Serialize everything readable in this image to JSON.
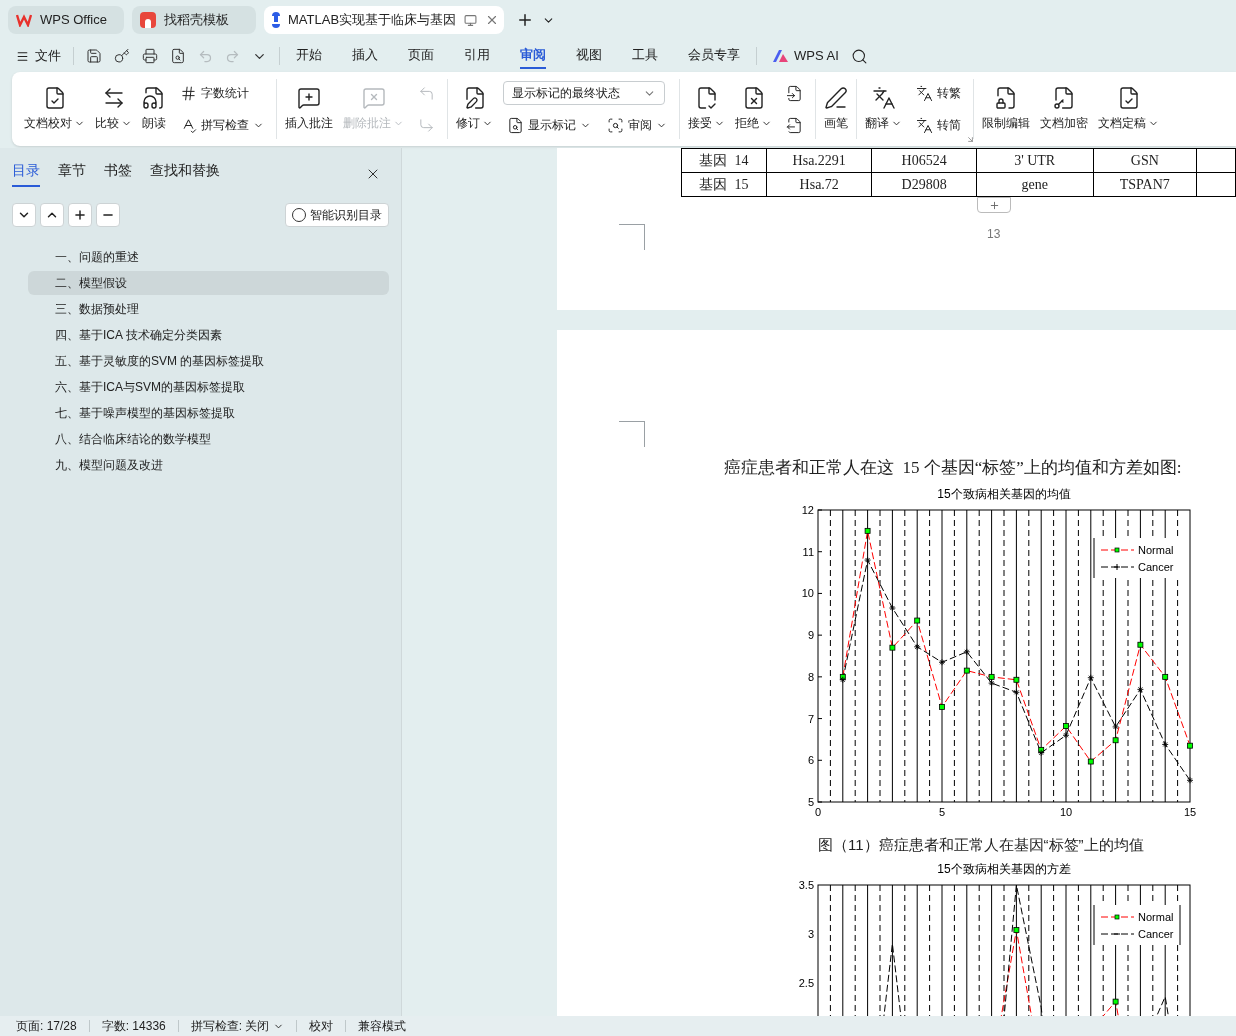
{
  "tabs": [
    {
      "label": "WPS Office",
      "selected": false
    },
    {
      "label": "找稻壳模板",
      "selected": false
    },
    {
      "label": "MATLAB实现基于临床与基因",
      "selected": true
    }
  ],
  "menu": {
    "file": "文件",
    "tabs": [
      {
        "label": "开始",
        "selected": false
      },
      {
        "label": "插入",
        "selected": false
      },
      {
        "label": "页面",
        "selected": false
      },
      {
        "label": "引用",
        "selected": false
      },
      {
        "label": "审阅",
        "selected": true
      },
      {
        "label": "视图",
        "selected": false
      },
      {
        "label": "工具",
        "selected": false
      },
      {
        "label": "会员专享",
        "selected": false
      }
    ],
    "ai": "WPS AI"
  },
  "ribbon": {
    "groups": [
      {
        "items": [
          {
            "kind": "large",
            "label": "文档校对",
            "menu": true,
            "disabled": false
          },
          {
            "kind": "large",
            "label": "比较",
            "menu": true,
            "disabled": false
          },
          {
            "kind": "large",
            "label": "朗读",
            "menu": false,
            "disabled": false
          },
          {
            "kind": "stack",
            "rows": [
              [
                {
                  "kind": "small",
                  "label": "字数统计",
                  "menu": false,
                  "disabled": false
                }
              ],
              [
                {
                  "kind": "small",
                  "label": "拼写检查",
                  "menu": true,
                  "disabled": false
                }
              ]
            ]
          }
        ]
      },
      {
        "items": [
          {
            "kind": "large",
            "label": "插入批注",
            "menu": false,
            "disabled": false
          },
          {
            "kind": "large",
            "label": "删除批注",
            "menu": true,
            "disabled": true
          },
          {
            "kind": "stack",
            "rows": [
              [
                {
                  "kind": "small",
                  "menu": false,
                  "disabled": true
                }
              ],
              [
                {
                  "kind": "small",
                  "menu": false,
                  "disabled": true
                }
              ]
            ]
          }
        ]
      },
      {
        "items": [
          {
            "kind": "large",
            "label": "修订",
            "menu": true,
            "disabled": false
          },
          {
            "kind": "stack",
            "rows": [
              [
                {
                  "kind": "select",
                  "value": "显示标记的最终状态"
                }
              ],
              [
                {
                  "kind": "small",
                  "label": "显示标记",
                  "menu": true,
                  "disabled": false
                },
                {
                  "kind": "small",
                  "label": "审阅",
                  "menu": true,
                  "disabled": false
                }
              ]
            ]
          }
        ]
      },
      {
        "items": [
          {
            "kind": "large",
            "label": "接受",
            "menu": true,
            "disabled": false
          },
          {
            "kind": "large",
            "label": "拒绝",
            "menu": true,
            "disabled": false
          },
          {
            "kind": "stack",
            "rows": [
              [
                {
                  "kind": "small",
                  "menu": false,
                  "disabled": false
                }
              ],
              [
                {
                  "kind": "small",
                  "menu": false,
                  "disabled": false
                }
              ]
            ]
          }
        ]
      },
      {
        "items": [
          {
            "kind": "large",
            "label": "画笔",
            "menu": false,
            "disabled": false
          }
        ]
      },
      {
        "items": [
          {
            "kind": "large",
            "label": "翻译",
            "menu": true,
            "disabled": false
          },
          {
            "kind": "stack",
            "rows": [
              [
                {
                  "kind": "small",
                  "label": "转繁",
                  "menu": false,
                  "disabled": false
                }
              ],
              [
                {
                  "kind": "small",
                  "label": "转简",
                  "menu": false,
                  "disabled": false
                }
              ]
            ]
          }
        ],
        "launcher": true
      },
      {
        "items": [
          {
            "kind": "large",
            "label": "限制编辑",
            "menu": false,
            "disabled": false
          },
          {
            "kind": "large",
            "label": "文档加密",
            "menu": false,
            "disabled": false
          },
          {
            "kind": "large",
            "label": "文档定稿",
            "menu": true,
            "disabled": false
          }
        ]
      }
    ]
  },
  "panel": {
    "tabs": [
      {
        "label": "目录",
        "selected": true
      },
      {
        "label": "章节",
        "selected": false
      },
      {
        "label": "书签",
        "selected": false
      },
      {
        "label": "查找和替换",
        "selected": false
      }
    ],
    "smart_button": "智能识别目录",
    "outline": [
      {
        "label": "一、问题的重述",
        "selected": false
      },
      {
        "label": "二、模型假设",
        "selected": true
      },
      {
        "label": "三、数据预处理",
        "selected": false
      },
      {
        "label": "四、基于ICA 技术确定分类因素",
        "selected": false
      },
      {
        "label": "五、基于灵敏度的SVM 的基因标签提取",
        "selected": false
      },
      {
        "label": "六、基于ICA与SVM的基因标签提取",
        "selected": false
      },
      {
        "label": "七、基于噪声模型的基因标签提取",
        "selected": false
      },
      {
        "label": "八、结合临床结论的数学模型",
        "selected": false
      },
      {
        "label": "九、模型问题及改进",
        "selected": false
      }
    ]
  },
  "document": {
    "table": {
      "rows": [
        [
          "基因  14",
          "Hsa.2291",
          "H06524",
          "3' UTR",
          "GSN"
        ],
        [
          "基因  15",
          "Hsa.72",
          "D29808",
          "gene",
          "TSPAN7"
        ]
      ]
    },
    "page_number": "13",
    "paragraph": "癌症患者和正常人在这  15 个基因“标签”上的均值和方差如图:",
    "figures": [
      {
        "chart_data": {
          "type": "line",
          "title": "15个致病相关基因的均值",
          "x": [
            1,
            2,
            3,
            4,
            5,
            6,
            7,
            8,
            9,
            10,
            11,
            12,
            13,
            14,
            15
          ],
          "xlim": [
            0,
            15
          ],
          "ylim": [
            5,
            12
          ],
          "xticks": [
            0,
            5,
            10,
            15
          ],
          "yticks": [
            5,
            6,
            7,
            8,
            9,
            10,
            11,
            12
          ],
          "legend": true,
          "series": [
            {
              "name": "Normal",
              "color": "#ff0000",
              "line_style": "dashed",
              "marker": "square",
              "values": [
                8.0,
                11.5,
                8.7,
                9.35,
                7.28,
                8.15,
                8.0,
                7.93,
                6.25,
                6.82,
                5.97,
                6.48,
                8.77,
                8.0,
                6.35
              ]
            },
            {
              "name": "Cancer",
              "color": "#000000",
              "line_style": "dashed",
              "marker": "cross",
              "values": [
                7.93,
                10.8,
                9.65,
                8.72,
                8.35,
                8.6,
                7.85,
                7.63,
                6.18,
                6.6,
                7.98,
                6.8,
                7.7,
                6.38,
                5.52
              ]
            }
          ]
        },
        "caption": "图（11）癌症患者和正常人在基因“标签”上的均值"
      },
      {
        "title": "15个致病相关基因的方差",
        "y_tick_labels": [
          "3.5",
          "3",
          "2.5"
        ],
        "legend": [
          "Normal",
          "Cancer"
        ]
      }
    ]
  },
  "status_bar": [
    {
      "label": "页面: 17/28",
      "menu": false
    },
    {
      "label": "字数: 14336",
      "menu": false
    },
    {
      "label": "拼写检查: 关闭",
      "menu": true
    },
    {
      "label": "校对",
      "menu": false
    },
    {
      "label": "兼容模式",
      "menu": false
    }
  ]
}
